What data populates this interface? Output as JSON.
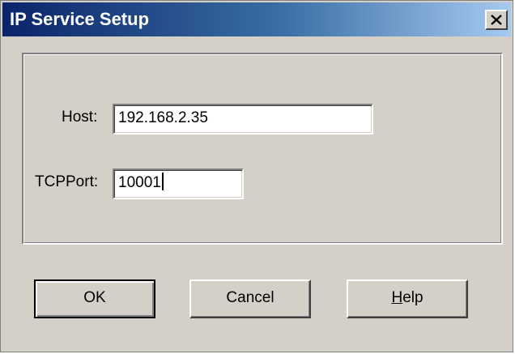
{
  "window": {
    "title": "IP Service Setup",
    "close_label": "close"
  },
  "form": {
    "host_label": "Host:",
    "host_value": "192.168.2.35",
    "port_label": "TCPPort:",
    "port_value": "10001"
  },
  "buttons": {
    "ok_label": "OK",
    "cancel_label": "Cancel",
    "help_mnemonic": "H",
    "help_rest": "elp"
  },
  "colors": {
    "title_gradient_start": "#0a246a",
    "title_gradient_end": "#a6caf0",
    "face": "#d4d0c8"
  },
  "icons": {
    "close": "close-icon"
  }
}
